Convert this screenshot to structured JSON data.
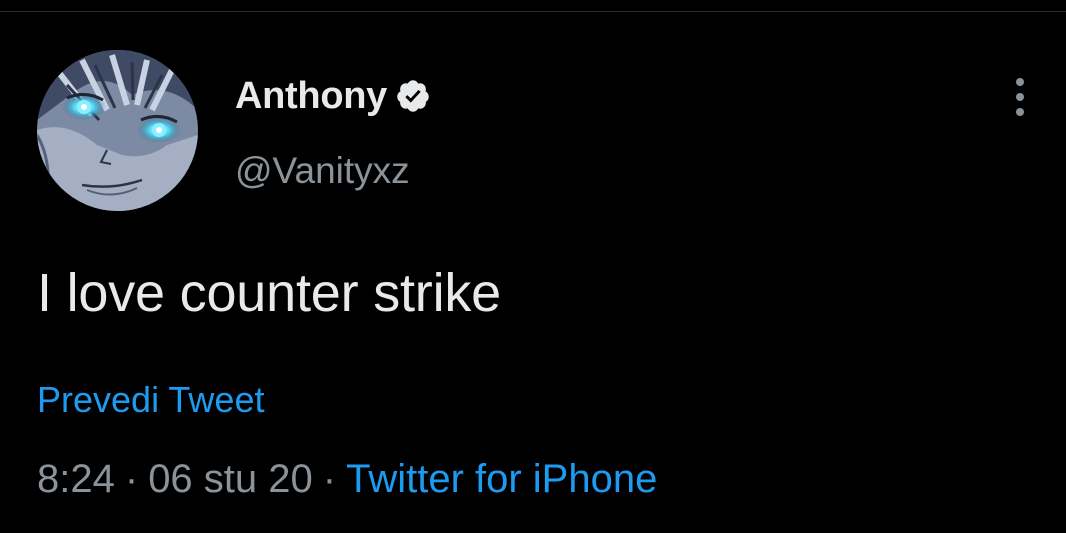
{
  "tweet": {
    "author": {
      "display_name": "Anthony",
      "handle": "@Vanityxz",
      "verified": true,
      "verified_icon": "verified-badge-icon"
    },
    "text": "I love counter strike",
    "translate_label": "Prevedi Tweet",
    "meta": {
      "time": "8:24",
      "separator": "·",
      "date": "06 stu 20",
      "source": "Twitter for iPhone"
    },
    "more_icon": "more-vertical-icon"
  },
  "colors": {
    "background": "#000000",
    "primary_text": "#e7e9ea",
    "secondary_text": "#8b9298",
    "accent": "#1d9bf0"
  }
}
